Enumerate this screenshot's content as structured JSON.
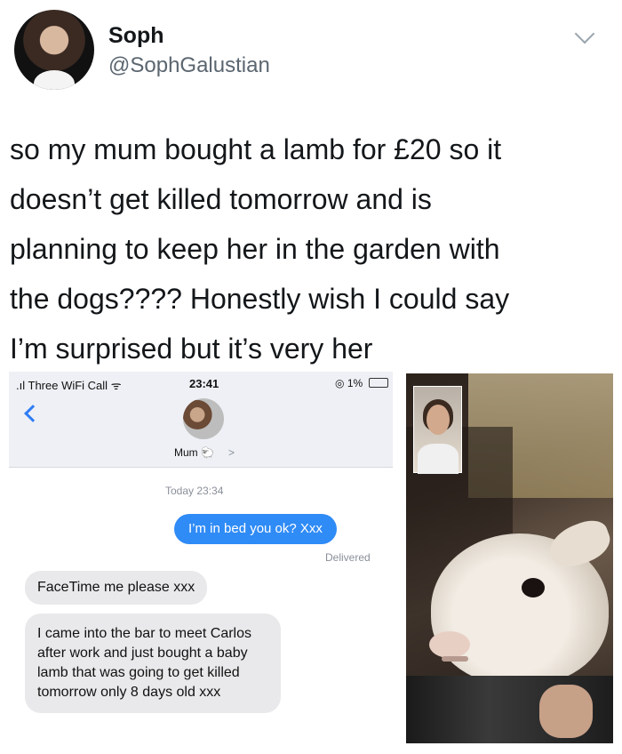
{
  "tweet": {
    "name": "Soph",
    "handle": "@SophGalustian",
    "lines": [
      "so my mum bought a lamb for £20 so it",
      "doesn’t get killed tomorrow and is",
      "planning to keep her in the garden with",
      "the dogs???? Honestly wish I could say",
      "I’m surprised but it’s very her"
    ]
  },
  "phone": {
    "carrier": "Three WiFi Call",
    "time": "23:41",
    "battery": "1%",
    "contact": "Mum",
    "contact_arrow": ">",
    "timestamp": "Today 23:34",
    "sent_message": "I’m in bed you ok? Xxx",
    "delivered": "Delivered",
    "received_1": "FaceTime  me please xxx",
    "received_2": "I came into the bar to meet Carlos after work and just bought a baby lamb that was going to get killed tomorrow only 8 days old xxx"
  },
  "icons": {
    "caret": "chevron-down-icon",
    "back": "chevron-left-icon",
    "signal": "signal-icon",
    "wifi": "wifi-icon",
    "battery": "battery-icon"
  },
  "colors": {
    "imessage_blue": "#2f8bf6",
    "received_gray": "#e9e9eb",
    "ios_link": "#2f7cf6"
  }
}
